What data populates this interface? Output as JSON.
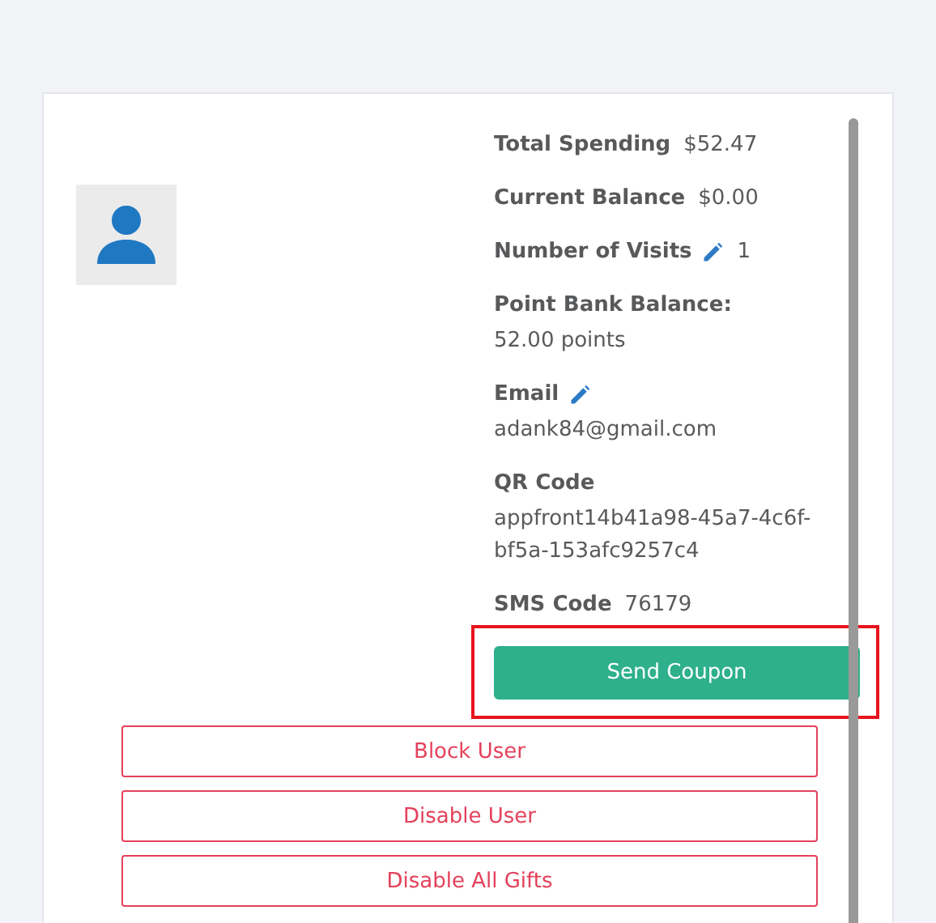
{
  "stats": [
    {
      "label": "Total Spending",
      "value": "$52.47",
      "kind": "inline",
      "editable": false
    },
    {
      "label": "Current Balance",
      "value": "$0.00",
      "kind": "inline",
      "editable": false
    },
    {
      "label": "Number of Visits",
      "value": "1",
      "kind": "inline",
      "editable": true
    },
    {
      "label": "Point Bank Balance:",
      "value": "52.00 points",
      "kind": "stacked",
      "editable": false
    },
    {
      "label": "Email",
      "value": "adank84@gmail.com",
      "kind": "stacked",
      "editable": true
    },
    {
      "label": "QR Code",
      "value": "appfront14b41a98-45a7-4c6f-bf5a-153afc9257c4",
      "kind": "stacked",
      "editable": false
    },
    {
      "label": "SMS Code",
      "value": "76179",
      "kind": "inline",
      "editable": false
    }
  ],
  "primary_button": {
    "label": "Send Coupon",
    "highlighted": true
  },
  "danger_buttons": [
    "Block User",
    "Disable User",
    "Disable All Gifts"
  ]
}
